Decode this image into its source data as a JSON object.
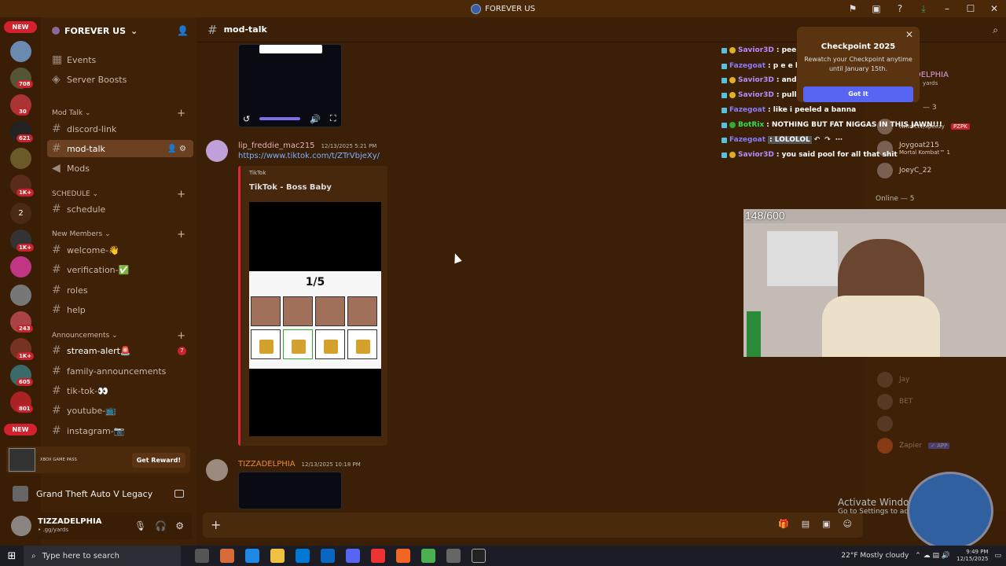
{
  "window": {
    "title": "FOREVER US"
  },
  "servers": {
    "new_label": "NEW",
    "badges": [
      "708",
      "30",
      "621",
      "1K+",
      "2",
      "1K+",
      "243",
      "1K+",
      "605",
      "801"
    ],
    "bottom_new": "NEW"
  },
  "guild": {
    "name": "FOREVER US"
  },
  "top_items": [
    {
      "label": "Events"
    },
    {
      "label": "Server Boosts"
    }
  ],
  "categories": {
    "mod_talk": "Mod Talk",
    "schedule": "SCHEDULE",
    "new_members": "New Members",
    "announcements": "Announcements"
  },
  "channels": {
    "discord_link": "discord-link",
    "mod_talk": "mod-talk",
    "mods": "Mods",
    "schedule": "schedule",
    "welcome": "welcome-👋",
    "verification": "verification-✅",
    "roles": "roles",
    "help": "help",
    "stream_alert": "stream-alert🚨",
    "stream_alert_count": "7",
    "family": "family-announcements",
    "tiktok": "tik-tok-👀",
    "youtube": "youtube-📺",
    "instagram": "instagram-📷"
  },
  "promo": {
    "text": "XBOX GAME PASS",
    "button": "Get Reward!"
  },
  "activity": {
    "game": "Grand Theft Auto V Legacy"
  },
  "user": {
    "name": "TIZZADELPHIA",
    "status": "• .gg/yards"
  },
  "header": {
    "channel": "mod-talk"
  },
  "messages": [
    {
      "author": "lip_freddie_mac215",
      "time": "12/13/2025 5:21 PM",
      "link": "https://www.tiktok.com/t/ZTrVbjeXy/",
      "embed_provider": "TikTok",
      "embed_title": "TikTok - Boss Baby",
      "counter": "1/5"
    },
    {
      "author": "TIZZADELPHIA",
      "time": "12/13/2025 10:18 PM"
    }
  ],
  "stream_chat": [
    {
      "user": "Savior3D",
      "text": ": peel",
      "color": "#b48cff"
    },
    {
      "user": "Fazegoat",
      "text": ": p e e l",
      "color": "#8a7cff"
    },
    {
      "user": "Savior3D",
      "text": ": and pill",
      "color": "#b48cff"
    },
    {
      "user": "Savior3D",
      "text": ": pull",
      "color": "#b48cff"
    },
    {
      "user": "Fazegoat",
      "text": ": like i peeled a banna",
      "color": "#8a7cff"
    },
    {
      "user": "BotRix",
      "text": ": NOTHING BUT FAT NIGGAS IN THIS JAWN!!!",
      "color": "#30e050"
    },
    {
      "user": "Fazegoat",
      "text": ": LOLOLOL",
      "color": "#8a7cff"
    },
    {
      "user": "Savior3D",
      "text": ": you said pool for all that shit",
      "color": "#b48cff"
    }
  ],
  "popup": {
    "title": "Checkpoint 2025",
    "body": "Rewatch your Checkpoint anytime until January 15th.",
    "button": "Got It"
  },
  "members": {
    "header_partial": "DELPHIA",
    "sub_partial": "yards",
    "online_label": "Online — 5",
    "section3": "— 3",
    "list": [
      {
        "name": "twitch.tv/xpeezy"
      },
      {
        "name": "Joygoat215",
        "sub": "Mortal Kombat™ 1"
      },
      {
        "name": "JoeyC_22"
      }
    ],
    "offline": [
      {
        "name": "Jay"
      },
      {
        "name": "BET"
      },
      {
        "name": ""
      },
      {
        "name": "Zapier",
        "tag": "✓ APP"
      }
    ],
    "pzpk": "PZPK"
  },
  "stream": {
    "counter": "148/600"
  },
  "watermark": {
    "title": "Activate Windows",
    "sub": "Go to Settings to ac"
  },
  "taskbar": {
    "search": "Type here to search",
    "weather": "22°F  Mostly cloudy",
    "time": "9:49 PM",
    "date": "12/15/2025"
  }
}
